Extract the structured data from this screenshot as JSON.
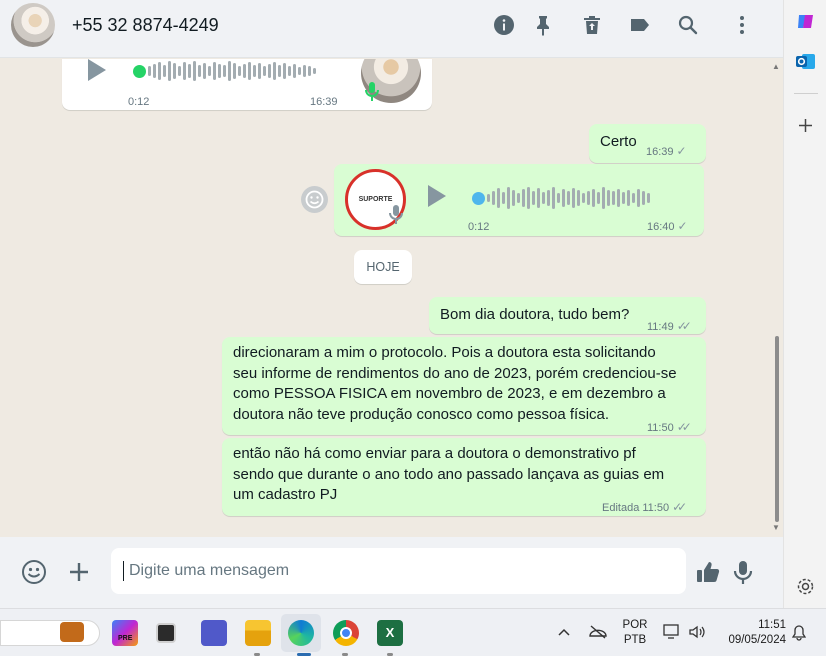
{
  "header": {
    "contact_name": "+55 32 8874-4249",
    "icons": [
      "info-icon",
      "pin-icon",
      "trash-icon",
      "label-icon",
      "search-icon",
      "menu-dots-icon"
    ]
  },
  "messages": {
    "audio_in": {
      "duration": "0:12",
      "time": "16:39"
    },
    "certo": {
      "text": "Certo",
      "time": "16:39"
    },
    "audio_out": {
      "duration": "0:12",
      "time": "16:40",
      "avatar_caption": "SUPORTE"
    },
    "date_divider": "HOJE",
    "bom_dia": {
      "text": "Bom dia doutora, tudo bem?",
      "time": "11:49"
    },
    "protocolo": {
      "lines": [
        "direcionaram a mim o protocolo. Pois a doutora esta solicitando",
        "seu informe de rendimentos do ano de 2023, porém credenciou-se",
        "como PESSOA FISICA em novembro de 2023, e em dezembro a",
        "doutora não teve produção conosco como pessoa física."
      ],
      "time": "11:50"
    },
    "pj": {
      "lines": [
        "então não há como enviar para a doutora o demonstrativo pf",
        "sendo que durante o ano todo ano passado lançava as guias em",
        "um cadastro PJ"
      ],
      "edited_label": "Editada",
      "time": "11:50"
    }
  },
  "composer": {
    "placeholder": "Digite uma mensagem"
  },
  "taskbar": {
    "lang_top": "POR",
    "lang_bottom": "PTB",
    "time": "11:51",
    "date": "09/05/2024",
    "copilot_badge": "PRE"
  },
  "colors": {
    "outgoing_bubble": "#d9fdd3",
    "incoming_bubble": "#ffffff",
    "chat_background": "#efeae2",
    "voice_dot_green": "#25d366",
    "voice_dot_blue": "#4fb6ec"
  }
}
